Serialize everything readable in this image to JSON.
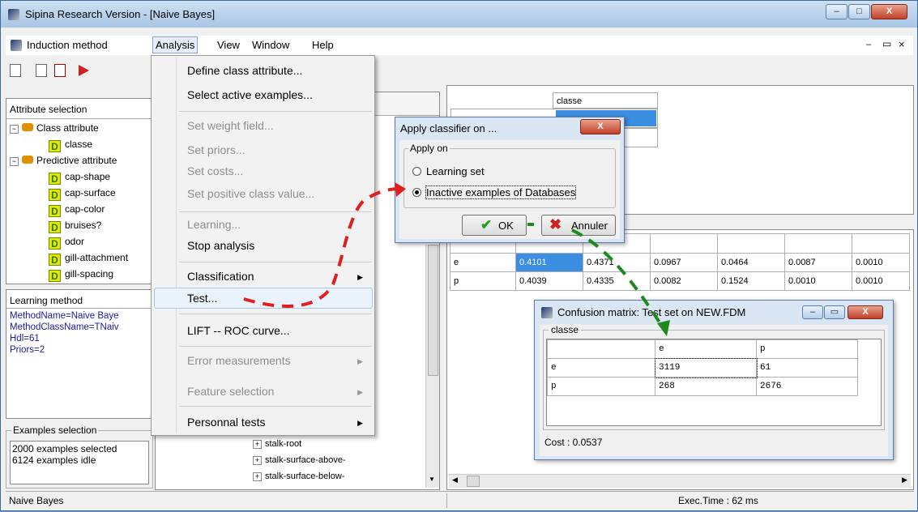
{
  "window": {
    "title": "Sipina Research Version - [Naive Bayes]",
    "min": "‒",
    "max": "□",
    "close": "X"
  },
  "menubar": {
    "items": [
      "Induction method",
      "Analysis",
      "View",
      "Window",
      "Help"
    ],
    "mdi": [
      "‒",
      "▭",
      "×"
    ]
  },
  "attr_selection": {
    "title": "Attribute selection",
    "class_group": "Class attribute",
    "class_attr": "classe",
    "pred_group": "Predictive attribute",
    "pred_attrs": [
      "cap-shape",
      "cap-surface",
      "cap-color",
      "bruises?",
      "odor",
      "gill-attachment",
      "gill-spacing"
    ]
  },
  "learning_method": {
    "title": "Learning method",
    "lines": [
      "MethodName=Naive Baye",
      "MethodClassName=TNaiv",
      "Hdl=61",
      "Priors=2"
    ]
  },
  "examples_selection": {
    "title": "Examples selection",
    "lines": [
      "2000 examples selected",
      "6124 examples idle"
    ]
  },
  "attr_list": [
    "stalk-root",
    "stalk-surface-above-",
    "stalk-surface-below-"
  ],
  "analysis_menu": {
    "items": [
      {
        "label": "Define class attribute...",
        "disabled": false
      },
      {
        "label": "Select active examples...",
        "disabled": false
      },
      {
        "label": "Set weight field...",
        "disabled": true
      },
      {
        "label": "Set priors...",
        "disabled": true
      },
      {
        "label": "Set costs...",
        "disabled": true
      },
      {
        "label": "Set positive class value...",
        "disabled": true
      },
      {
        "label": "Learning...",
        "disabled": true
      },
      {
        "label": "Stop analysis",
        "disabled": false
      },
      {
        "label": "Classification",
        "disabled": false,
        "submenu": true
      },
      {
        "label": "Test...",
        "disabled": false
      },
      {
        "label": "LIFT -- ROC curve...",
        "disabled": false
      },
      {
        "label": "Error measurements",
        "disabled": true,
        "submenu": true
      },
      {
        "label": "Feature selection",
        "disabled": true,
        "submenu": true
      },
      {
        "label": "Personnal tests",
        "disabled": false,
        "submenu": true
      }
    ]
  },
  "right_top": {
    "header": "classe"
  },
  "prob_table": {
    "rows": [
      {
        "label": "e",
        "values": [
          "0.4101",
          "0.4371",
          "0.0967",
          "0.0464",
          "0.0087",
          "0.0010"
        ]
      },
      {
        "label": "p",
        "values": [
          "0.4039",
          "0.4335",
          "0.0082",
          "0.1524",
          "0.0010",
          "0.0010"
        ]
      }
    ]
  },
  "apply_dialog": {
    "title": "Apply classifier on ...",
    "close": "X",
    "group": "Apply on",
    "options": [
      "Learning set",
      "Inactive examples of Databases"
    ],
    "selected": 1,
    "ok": "OK",
    "cancel": "Annuler"
  },
  "confusion": {
    "title": "Confusion matrix: Test set on NEW.FDM",
    "group": "classe",
    "cols": [
      "e",
      "p"
    ],
    "rows": [
      {
        "label": "e",
        "values": [
          "3119",
          "61"
        ]
      },
      {
        "label": "p",
        "values": [
          "268",
          "2676"
        ]
      }
    ],
    "cost": "Cost : 0.0537"
  },
  "status": {
    "left": "Naive Bayes",
    "right": "Exec.Time : 62 ms"
  },
  "colors": {
    "arrow": "#e02020",
    "arrow2": "#1e8a1e"
  }
}
